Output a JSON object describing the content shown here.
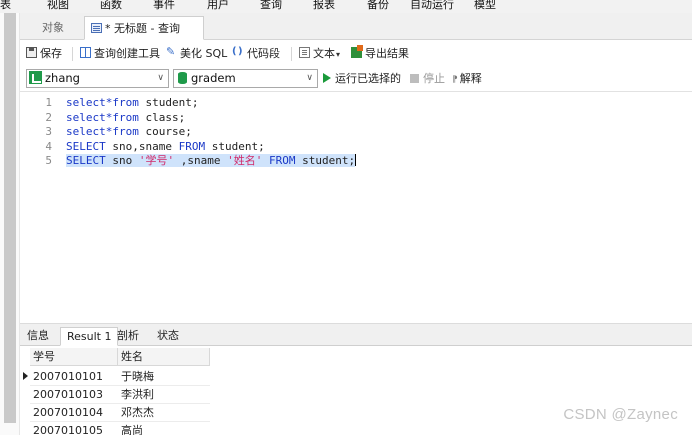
{
  "menu": {
    "items": [
      "表",
      "视图",
      "函数",
      "事件",
      "用户",
      "查询",
      "报表",
      "备份",
      "自动运行",
      "模型"
    ]
  },
  "tabs": {
    "objects": "对象",
    "query": "* 无标题 - 查询"
  },
  "toolbar": {
    "save": "保存",
    "query_builder": "查询创建工具",
    "beautify_sql": "美化 SQL",
    "code_snippet": "代码段",
    "text": "文本",
    "export_result": "导出结果"
  },
  "selectors": {
    "connection": "zhang",
    "database": "gradem"
  },
  "actions": {
    "run_selected": "运行已选择的",
    "stop": "停止",
    "explain": "解释"
  },
  "editor": {
    "line_numbers": [
      "1",
      "2",
      "3",
      "4",
      "5"
    ],
    "lines": [
      [
        {
          "t": "select*",
          "k": "kw"
        },
        {
          "t": "from",
          "k": "kw"
        },
        {
          "t": " student;",
          "k": ""
        }
      ],
      [
        {
          "t": "select*",
          "k": "kw"
        },
        {
          "t": "from",
          "k": "kw"
        },
        {
          "t": " class;",
          "k": ""
        }
      ],
      [
        {
          "t": "select*",
          "k": "kw"
        },
        {
          "t": "from",
          "k": "kw"
        },
        {
          "t": " course;",
          "k": ""
        }
      ],
      [
        {
          "t": "SELECT",
          "k": "kw"
        },
        {
          "t": " sno,sname ",
          "k": ""
        },
        {
          "t": "FROM",
          "k": "kw"
        },
        {
          "t": " student;",
          "k": ""
        }
      ],
      [
        {
          "t": "SELECT",
          "k": "kw"
        },
        {
          "t": " sno ",
          "k": ""
        },
        {
          "t": "'学号'",
          "k": "str"
        },
        {
          "t": " ,sname ",
          "k": ""
        },
        {
          "t": "'姓名'",
          "k": "str"
        },
        {
          "t": " ",
          "k": ""
        },
        {
          "t": "FROM",
          "k": "kw"
        },
        {
          "t": " student;",
          "k": ""
        }
      ]
    ],
    "selected_line": 4
  },
  "result_tabs": {
    "info": "信息",
    "result1": "Result 1",
    "profile": "剖析",
    "status": "状态"
  },
  "result_grid": {
    "headers": [
      "学号",
      "姓名"
    ],
    "rows": [
      [
        "2007010101",
        "于晓梅"
      ],
      [
        "2007010103",
        "李洪利"
      ],
      [
        "2007010104",
        "邓杰杰"
      ],
      [
        "2007010105",
        "高尚"
      ]
    ]
  },
  "watermark": "CSDN @Zaynec"
}
